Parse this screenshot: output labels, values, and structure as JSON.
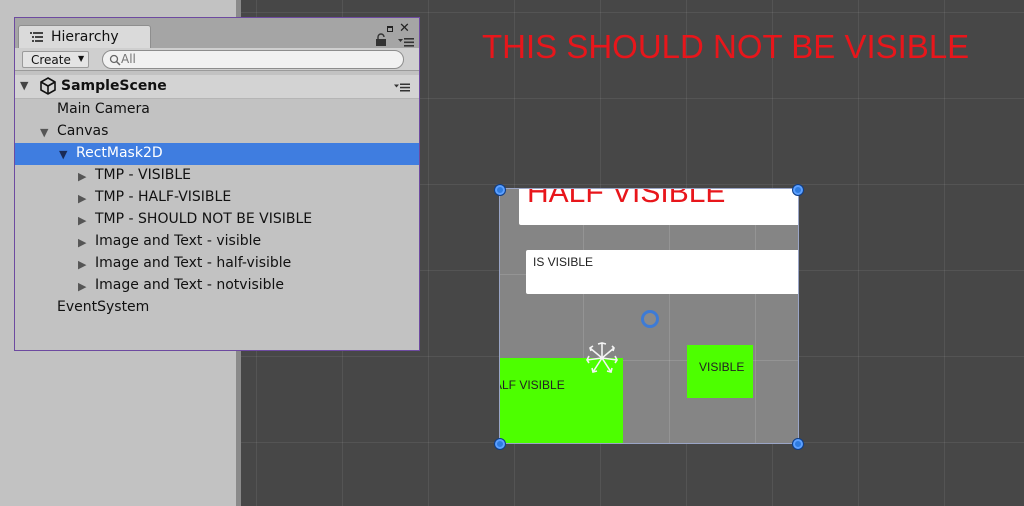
{
  "hierarchy": {
    "tab_title": "Hierarchy",
    "create_label": "Create",
    "search_placeholder": "All",
    "scene_name": "SampleScene",
    "items": [
      {
        "label": "Main Camera",
        "indent": 0,
        "has_arrow": false
      },
      {
        "label": "Canvas",
        "indent": 0,
        "has_arrow": true,
        "expanded": true
      },
      {
        "label": "RectMask2D",
        "indent": 1,
        "has_arrow": true,
        "expanded": true,
        "selected": true
      },
      {
        "label": "TMP - VISIBLE",
        "indent": 2,
        "has_arrow": true
      },
      {
        "label": "TMP - HALF-VISIBLE",
        "indent": 2,
        "has_arrow": true
      },
      {
        "label": "TMP - SHOULD NOT BE VISIBLE",
        "indent": 2,
        "has_arrow": true
      },
      {
        "label": "Image and Text - visible",
        "indent": 2,
        "has_arrow": true
      },
      {
        "label": "Image and Text - half-visible",
        "indent": 2,
        "has_arrow": true
      },
      {
        "label": "Image and Text - notvisible",
        "indent": 2,
        "has_arrow": true
      },
      {
        "label": "EventSystem",
        "indent": 0,
        "has_arrow": false
      }
    ]
  },
  "scene": {
    "red_text": "THIS SHOULD NOT BE VISIBLE",
    "half_visible_text": "HALF VISIBLE",
    "is_visible_text": "IS VISIBLE",
    "green_half_text": "ALF VISIBLE",
    "green_visible_text": "VISIBLE"
  },
  "colors": {
    "selection": "#3f7de0",
    "warning_red": "#e8161b",
    "green": "#4dff00",
    "handle_blue": "#2f7ce0"
  }
}
